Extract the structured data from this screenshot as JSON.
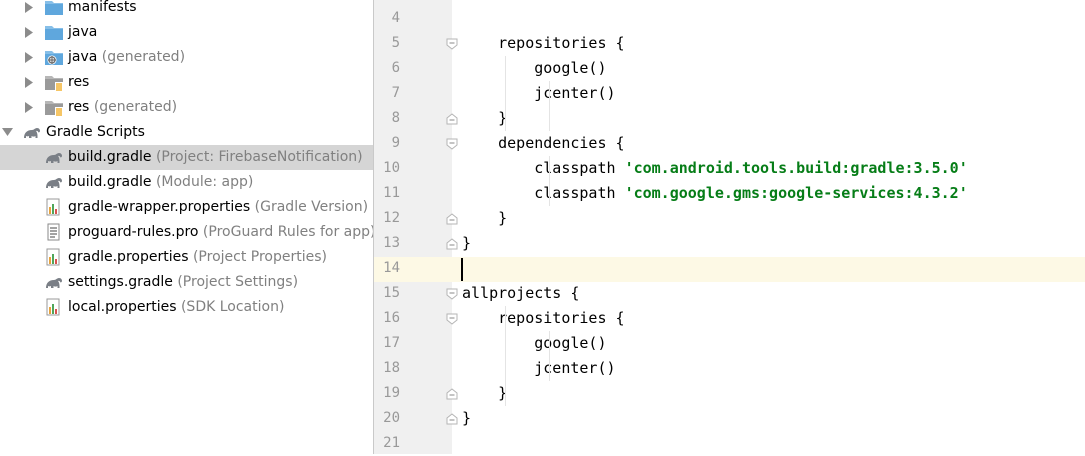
{
  "tree": [
    {
      "label": "manifests",
      "hint": "",
      "icon": "folder-icon",
      "arrow": "collapsed"
    },
    {
      "label": "java",
      "hint": "",
      "icon": "folder-icon",
      "arrow": "collapsed"
    },
    {
      "label": "java",
      "hint": "(generated)",
      "icon": "generated-folder-icon",
      "arrow": "collapsed"
    },
    {
      "label": "res",
      "hint": "",
      "icon": "res-folder-icon",
      "arrow": "collapsed"
    },
    {
      "label": "res",
      "hint": "(generated)",
      "icon": "res-folder-icon",
      "arrow": "collapsed"
    },
    {
      "label": "Gradle Scripts",
      "hint": "",
      "icon": "gradle-icon",
      "arrow": "expanded"
    },
    {
      "label": "build.gradle",
      "hint": "(Project: FirebaseNotification)",
      "icon": "gradle-icon",
      "arrow": "none",
      "selected": true
    },
    {
      "label": "build.gradle",
      "hint": "(Module: app)",
      "icon": "gradle-icon",
      "arrow": "none"
    },
    {
      "label": "gradle-wrapper.properties",
      "hint": "(Gradle Version)",
      "icon": "properties-icon",
      "arrow": "none"
    },
    {
      "label": "proguard-rules.pro",
      "hint": "(ProGuard Rules for app)",
      "icon": "text-file-icon",
      "arrow": "none"
    },
    {
      "label": "gradle.properties",
      "hint": "(Project Properties)",
      "icon": "properties-icon",
      "arrow": "none"
    },
    {
      "label": "settings.gradle",
      "hint": "(Project Settings)",
      "icon": "gradle-icon",
      "arrow": "none"
    },
    {
      "label": "local.properties",
      "hint": "(SDK Location)",
      "icon": "properties-icon",
      "arrow": "none"
    }
  ],
  "editor": {
    "lines": [
      {
        "num": "4",
        "code": "",
        "str": "",
        "fold": ""
      },
      {
        "num": "5",
        "code": "    repositories {",
        "str": "",
        "fold": "open"
      },
      {
        "num": "6",
        "code": "        google()",
        "str": "",
        "fold": ""
      },
      {
        "num": "7",
        "code": "        jcenter()",
        "str": "",
        "fold": ""
      },
      {
        "num": "8",
        "code": "    }",
        "str": "",
        "fold": "close"
      },
      {
        "num": "9",
        "code": "    dependencies {",
        "str": "",
        "fold": "open"
      },
      {
        "num": "10",
        "code": "        classpath ",
        "str": "'com.android.tools.build:gradle:3.5.0'",
        "fold": ""
      },
      {
        "num": "11",
        "code": "        classpath ",
        "str": "'com.google.gms:google-services:4.3.2'",
        "fold": ""
      },
      {
        "num": "12",
        "code": "    }",
        "str": "",
        "fold": "close"
      },
      {
        "num": "13",
        "code": "}",
        "str": "",
        "fold": "close"
      },
      {
        "num": "14",
        "code": "",
        "str": "",
        "fold": ""
      },
      {
        "num": "15",
        "code": "allprojects {",
        "str": "",
        "fold": "open"
      },
      {
        "num": "16",
        "code": "    repositories {",
        "str": "",
        "fold": "open"
      },
      {
        "num": "17",
        "code": "        google()",
        "str": "",
        "fold": ""
      },
      {
        "num": "18",
        "code": "        jcenter()",
        "str": "",
        "fold": ""
      },
      {
        "num": "19",
        "code": "    }",
        "str": "",
        "fold": "close"
      },
      {
        "num": "20",
        "code": "}",
        "str": "",
        "fold": "close"
      },
      {
        "num": "21",
        "code": "",
        "str": "",
        "fold": ""
      }
    ],
    "current_line": "14"
  },
  "colors": {
    "selected_row": "#d5d5d5",
    "string_literal": "#067d17",
    "hint_text": "#808080",
    "line_number": "#999999",
    "current_line_bg": "#fdf9e5"
  }
}
